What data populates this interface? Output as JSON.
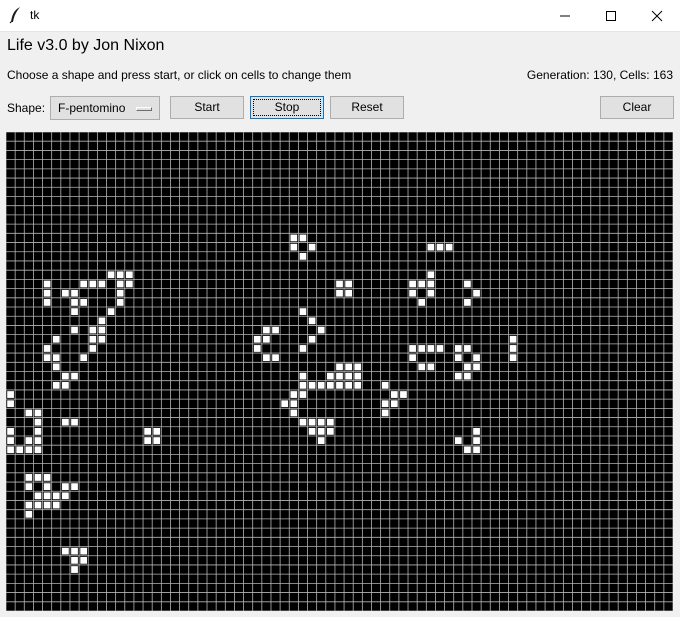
{
  "window": {
    "title": "tk",
    "icon": "feather-icon",
    "controls": [
      "minimize-icon",
      "maximize-icon",
      "close-icon"
    ]
  },
  "app": {
    "heading": "Life v3.0 by Jon Nixon",
    "instructions": "Choose a shape and press start, or click on cells to change them",
    "status": "Generation: 130, Cells: 163"
  },
  "controls": {
    "shape_label": "Shape:",
    "shape_value": "F-pentomino",
    "start_label": "Start",
    "stop_label": "Stop",
    "reset_label": "Reset",
    "clear_label": "Clear"
  },
  "grid": {
    "cols": 73,
    "rows": 52,
    "live_color": "#ffffff",
    "dead_color": "#000000",
    "line_color": "#b4b4b4",
    "live_cells": [
      [
        31,
        11
      ],
      [
        32,
        11
      ],
      [
        31,
        12
      ],
      [
        33,
        12
      ],
      [
        32,
        13
      ],
      [
        46,
        12
      ],
      [
        47,
        12
      ],
      [
        48,
        12
      ],
      [
        11,
        15
      ],
      [
        12,
        15
      ],
      [
        13,
        15
      ],
      [
        10,
        16
      ],
      [
        12,
        16
      ],
      [
        13,
        16
      ],
      [
        46,
        15
      ],
      [
        45,
        16
      ],
      [
        46,
        16
      ],
      [
        4,
        16
      ],
      [
        4,
        17
      ],
      [
        4,
        18
      ],
      [
        6,
        17
      ],
      [
        7,
        17
      ],
      [
        8,
        16
      ],
      [
        9,
        16
      ],
      [
        8,
        18
      ],
      [
        12,
        17
      ],
      [
        12,
        18
      ],
      [
        11,
        19
      ],
      [
        10,
        20
      ],
      [
        7,
        18
      ],
      [
        7,
        19
      ],
      [
        7,
        21
      ],
      [
        9,
        21
      ],
      [
        10,
        21
      ],
      [
        9,
        22
      ],
      [
        10,
        22
      ],
      [
        9,
        23
      ],
      [
        8,
        24
      ],
      [
        36,
        16
      ],
      [
        37,
        16
      ],
      [
        36,
        17
      ],
      [
        37,
        17
      ],
      [
        44,
        16
      ],
      [
        44,
        17
      ],
      [
        45,
        18
      ],
      [
        46,
        17
      ],
      [
        50,
        16
      ],
      [
        51,
        17
      ],
      [
        50,
        18
      ],
      [
        32,
        19
      ],
      [
        33,
        20
      ],
      [
        34,
        21
      ],
      [
        33,
        22
      ],
      [
        32,
        23
      ],
      [
        28,
        21
      ],
      [
        29,
        21
      ],
      [
        27,
        22
      ],
      [
        28,
        22
      ],
      [
        27,
        23
      ],
      [
        28,
        24
      ],
      [
        29,
        24
      ],
      [
        4,
        23
      ],
      [
        5,
        22
      ],
      [
        4,
        24
      ],
      [
        5,
        24
      ],
      [
        5,
        25
      ],
      [
        6,
        26
      ],
      [
        7,
        26
      ],
      [
        5,
        27
      ],
      [
        6,
        27
      ],
      [
        55,
        22
      ],
      [
        55,
        23
      ],
      [
        55,
        24
      ],
      [
        44,
        23
      ],
      [
        45,
        23
      ],
      [
        46,
        23
      ],
      [
        47,
        23
      ],
      [
        44,
        24
      ],
      [
        45,
        25
      ],
      [
        46,
        25
      ],
      [
        49,
        23
      ],
      [
        50,
        23
      ],
      [
        49,
        24
      ],
      [
        51,
        24
      ],
      [
        50,
        25
      ],
      [
        49,
        26
      ],
      [
        50,
        26
      ],
      [
        51,
        25
      ],
      [
        36,
        25
      ],
      [
        37,
        25
      ],
      [
        38,
        25
      ],
      [
        35,
        26
      ],
      [
        36,
        26
      ],
      [
        37,
        26
      ],
      [
        38,
        26
      ],
      [
        32,
        26
      ],
      [
        32,
        27
      ],
      [
        33,
        27
      ],
      [
        34,
        27
      ],
      [
        35,
        27
      ],
      [
        36,
        27
      ],
      [
        37,
        27
      ],
      [
        38,
        27
      ],
      [
        31,
        28
      ],
      [
        32,
        28
      ],
      [
        30,
        29
      ],
      [
        31,
        29
      ],
      [
        31,
        30
      ],
      [
        41,
        27
      ],
      [
        42,
        28
      ],
      [
        41,
        29
      ],
      [
        42,
        29
      ],
      [
        43,
        28
      ],
      [
        41,
        30
      ],
      [
        0,
        28
      ],
      [
        0,
        29
      ],
      [
        2,
        30
      ],
      [
        3,
        30
      ],
      [
        3,
        31
      ],
      [
        3,
        32
      ],
      [
        3,
        33
      ],
      [
        2,
        33
      ],
      [
        1,
        34
      ],
      [
        2,
        34
      ],
      [
        3,
        34
      ],
      [
        0,
        32
      ],
      [
        0,
        33
      ],
      [
        0,
        34
      ],
      [
        6,
        31
      ],
      [
        7,
        31
      ],
      [
        32,
        31
      ],
      [
        33,
        31
      ],
      [
        34,
        31
      ],
      [
        35,
        31
      ],
      [
        33,
        32
      ],
      [
        34,
        32
      ],
      [
        35,
        32
      ],
      [
        34,
        33
      ],
      [
        15,
        32
      ],
      [
        16,
        32
      ],
      [
        15,
        33
      ],
      [
        16,
        33
      ],
      [
        51,
        32
      ],
      [
        51,
        33
      ],
      [
        51,
        34
      ],
      [
        49,
        33
      ],
      [
        50,
        34
      ],
      [
        2,
        37
      ],
      [
        3,
        37
      ],
      [
        4,
        37
      ],
      [
        2,
        38
      ],
      [
        4,
        38
      ],
      [
        3,
        39
      ],
      [
        4,
        39
      ],
      [
        5,
        39
      ],
      [
        6,
        38
      ],
      [
        7,
        38
      ],
      [
        6,
        39
      ],
      [
        2,
        40
      ],
      [
        3,
        40
      ],
      [
        4,
        40
      ],
      [
        5,
        40
      ],
      [
        2,
        41
      ],
      [
        6,
        45
      ],
      [
        7,
        45
      ],
      [
        8,
        45
      ],
      [
        7,
        46
      ],
      [
        8,
        46
      ],
      [
        7,
        47
      ]
    ]
  }
}
